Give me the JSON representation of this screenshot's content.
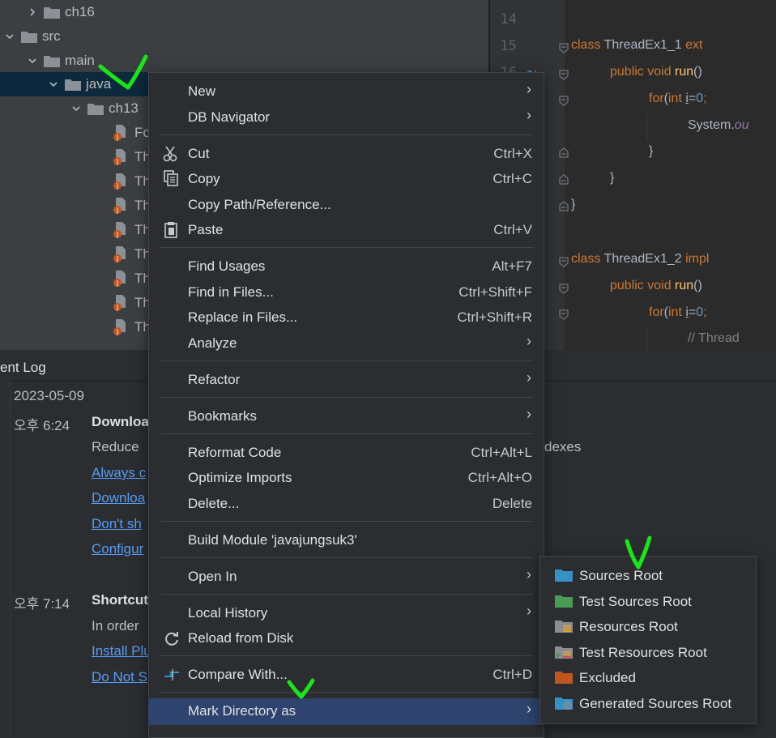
{
  "tree": {
    "items": [
      {
        "label": "ch16",
        "type": "folder",
        "expanded": false
      },
      {
        "label": "src",
        "type": "folder",
        "expanded": true
      },
      {
        "label": "main",
        "type": "folder",
        "expanded": true
      },
      {
        "label": "java",
        "type": "folder",
        "expanded": true,
        "selected": true
      },
      {
        "label": "ch13",
        "type": "folder",
        "expanded": true
      }
    ],
    "files": [
      "Fo",
      "Th",
      "Th",
      "Th",
      "Th",
      "Th",
      "Th",
      "Th",
      "Th"
    ]
  },
  "editor": {
    "line_numbers": [
      "14",
      "15",
      "16"
    ],
    "lines": [
      "",
      "class ThreadEx1_1 ext",
      "    public void run()",
      "        for(int i=0; ",
      "            System.ou",
      "        }",
      "    }",
      "}",
      "",
      "class ThreadEx1_2 impl",
      "    public void run()",
      "        for(int i=0; ",
      "            // Thread"
    ]
  },
  "event_log": {
    "tab_label": "ent Log",
    "date": "2023-05-09",
    "entries": [
      {
        "time": "오후 6:24",
        "title": "Downloa",
        "body": "Reduce",
        "body_tail": "dexes",
        "links": [
          "Always c",
          "Downloa",
          "Don't sh",
          "Configur"
        ]
      },
      {
        "time": "오후 7:14",
        "title": "Shortcut",
        "body": "In order",
        "links": [
          "Install Plu",
          "Do Not S"
        ]
      }
    ]
  },
  "context_menu": {
    "items": [
      {
        "label": "New",
        "submenu": true
      },
      {
        "label": "DB Navigator",
        "submenu": true
      },
      {
        "label": "Cut",
        "shortcut": "Ctrl+X",
        "icon": "scissors-icon"
      },
      {
        "label": "Copy",
        "shortcut": "Ctrl+C",
        "icon": "copy-icon"
      },
      {
        "label": "Copy Path/Reference..."
      },
      {
        "label": "Paste",
        "shortcut": "Ctrl+V",
        "icon": "clipboard-icon"
      },
      {
        "label": "Find Usages",
        "shortcut": "Alt+F7"
      },
      {
        "label": "Find in Files...",
        "shortcut": "Ctrl+Shift+F"
      },
      {
        "label": "Replace in Files...",
        "shortcut": "Ctrl+Shift+R"
      },
      {
        "label": "Analyze",
        "submenu": true
      },
      {
        "label": "Refactor",
        "submenu": true
      },
      {
        "label": "Bookmarks",
        "submenu": true
      },
      {
        "label": "Reformat Code",
        "shortcut": "Ctrl+Alt+L"
      },
      {
        "label": "Optimize Imports",
        "shortcut": "Ctrl+Alt+O"
      },
      {
        "label": "Delete...",
        "shortcut": "Delete"
      },
      {
        "label": "Build Module 'javajungsuk3'"
      },
      {
        "label": "Open In",
        "submenu": true
      },
      {
        "label": "Local History",
        "submenu": true
      },
      {
        "label": "Reload from Disk",
        "icon": "reload-icon"
      },
      {
        "label": "Compare With...",
        "shortcut": "Ctrl+D",
        "icon": "compare-icon"
      },
      {
        "label": "Mark Directory as",
        "submenu": true,
        "highlighted": true
      }
    ]
  },
  "submenu": {
    "items": [
      {
        "label": "Sources Root",
        "color": "#3592c4"
      },
      {
        "label": "Test Sources Root",
        "color": "#499c54"
      },
      {
        "label": "Resources Root",
        "color": "#8a8d94"
      },
      {
        "label": "Test Resources Root",
        "color": "#8a8d94"
      },
      {
        "label": "Excluded",
        "color": "#c0561f"
      },
      {
        "label": "Generated Sources Root",
        "color": "#3592c4"
      }
    ]
  },
  "colors": {
    "selection": "#2e436e",
    "annotation_check": "#19e619"
  }
}
